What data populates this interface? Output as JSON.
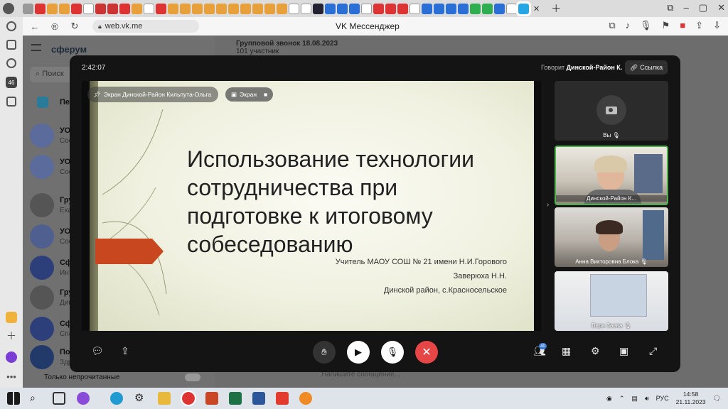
{
  "browser": {
    "url": "web.vk.me",
    "title": "VK Мессенджер"
  },
  "messenger": {
    "brand": "сферум",
    "search_placeholder": "Поиск",
    "chats": [
      {
        "name": "УО",
        "sub": "Соо"
      },
      {
        "name": "УО",
        "sub": "Соо"
      },
      {
        "name": "Груп",
        "sub": "Exa"
      },
      {
        "name": "УО",
        "sub": "Соо"
      },
      {
        "name": "Сфе",
        "sub": "Инт"
      },
      {
        "name": "Груп",
        "sub": "Дин"
      },
      {
        "name": "Сфе",
        "sub": "Спа"
      },
      {
        "name": "Пом",
        "sub": "Здр"
      }
    ],
    "pinned_label": "Пере",
    "header_title": "Групповой звонок 18.08.2023",
    "header_sub": "101 участник",
    "only_unread_label": "Только непрочитанные",
    "message_placeholder": "Напишите сообщение..."
  },
  "call": {
    "timer": "2:42:07",
    "speaking_label": "Говорит",
    "speaking_name": "Динской-Район К.",
    "link_label": "Ссылка",
    "share_tag": "Экран Динской-Район Кильпута-Ольга",
    "screen_badge": "Экран",
    "participants_count": "40",
    "participants": [
      {
        "name": "Вы"
      },
      {
        "name": "Динской-Район К..."
      },
      {
        "name": "Анна Викторовна Блока"
      },
      {
        "name": "Вера Заева"
      }
    ]
  },
  "slide": {
    "title_lines": [
      "Использование технологии",
      "сотрудничества при",
      "подготовке к итоговому",
      "собеседованию"
    ],
    "subtitle_lines": [
      "Учитель МАОУ СОШ № 21 имени Н.И.Горового",
      "Заверюха Н.Н.",
      "Динской район, с.Красносельское"
    ],
    "accent_color": "#c8471f"
  },
  "taskbar": {
    "lang": "РУС",
    "time": "14:58",
    "date": "21.11.2023"
  }
}
